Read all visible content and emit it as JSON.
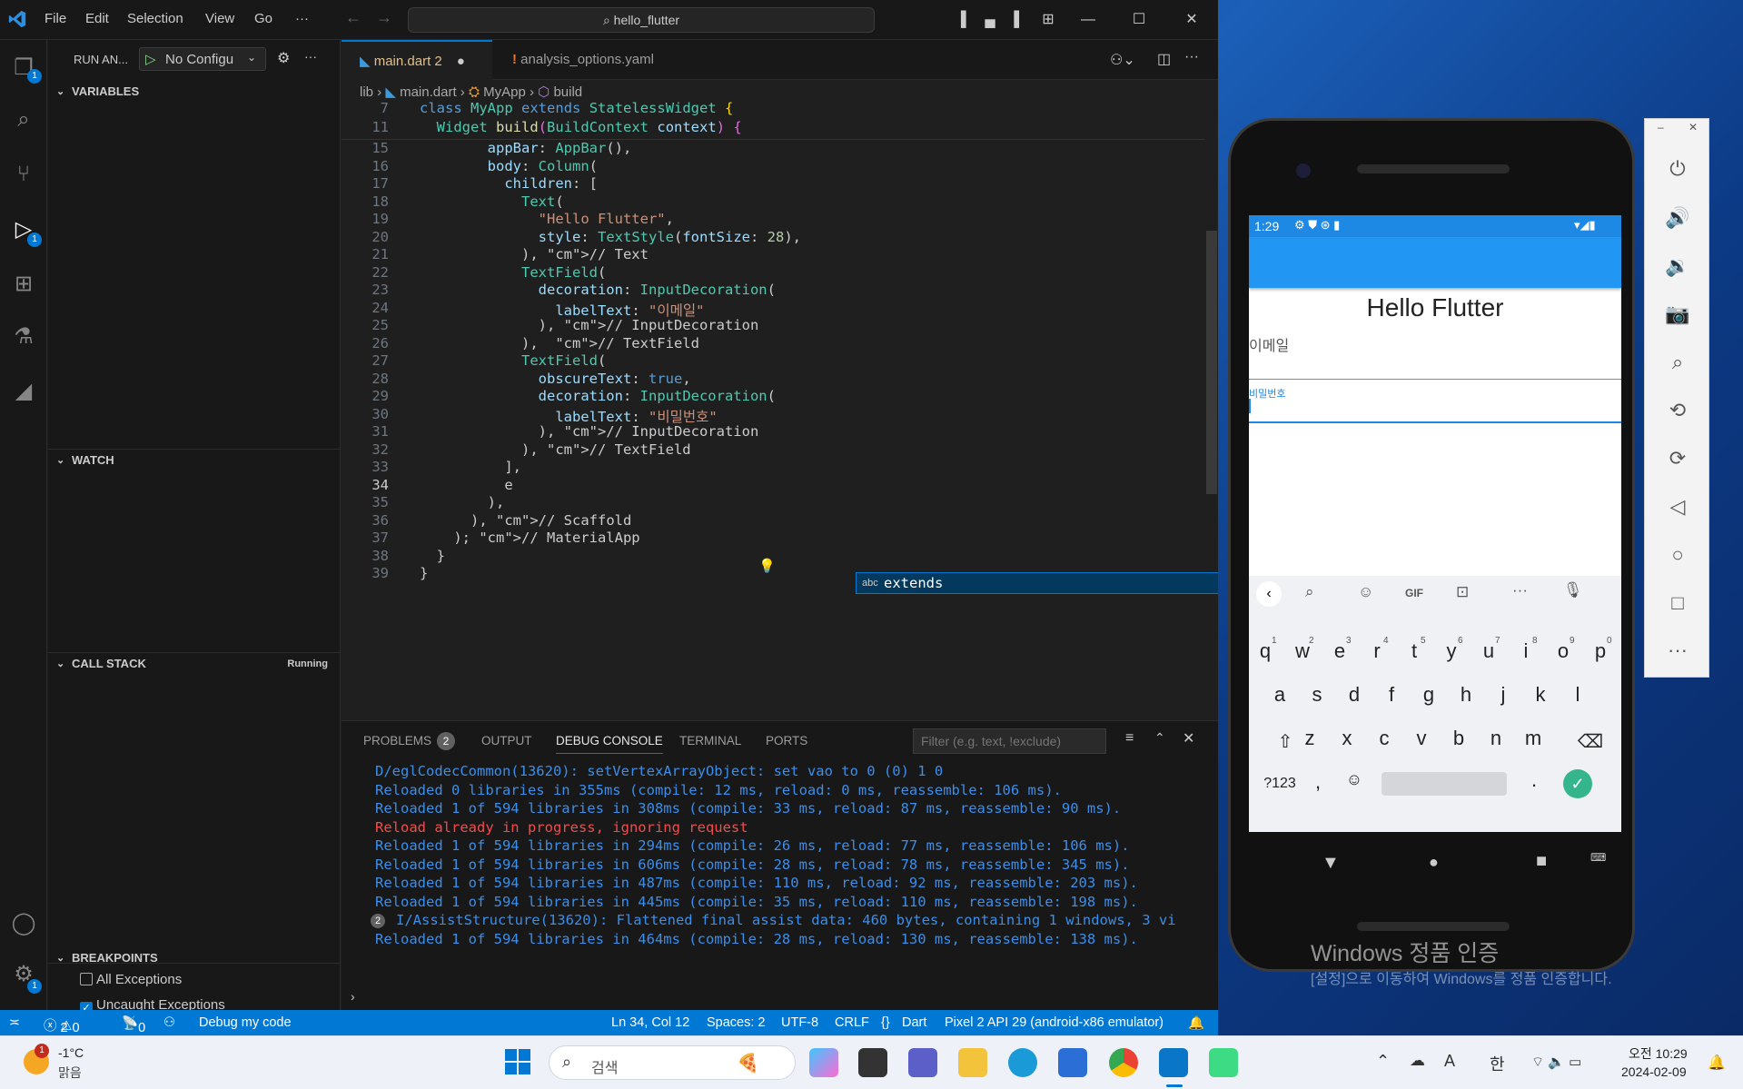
{
  "window": {
    "menus": [
      "File",
      "Edit",
      "Selection",
      "View",
      "Go",
      "···"
    ],
    "search": "hello_flutter"
  },
  "sidebar": {
    "run_label": "RUN AN...",
    "config": "No Configu",
    "variables": "VARIABLES",
    "watch": "WATCH",
    "call_stack": "CALL STACK",
    "call_stack_state": "Running",
    "breakpoints": "BREAKPOINTS",
    "all_exceptions": "All Exceptions",
    "uncaught_exceptions": "Uncaught Exceptions"
  },
  "activity": {
    "explorer_badge": "1",
    "debug_badge": "1",
    "settings_badge": "1"
  },
  "tabs": [
    {
      "label": "main.dart 2"
    },
    {
      "label": "analysis_options.yaml"
    }
  ],
  "breadcrumbs": [
    "lib",
    "main.dart",
    "MyApp",
    "build"
  ],
  "sticky": [
    {
      "ln": "7",
      "text": "class MyApp extends StatelessWidget {"
    },
    {
      "ln": "11",
      "text": "  Widget build(BuildContext context) {"
    }
  ],
  "code": [
    {
      "ln": "15",
      "text": "        appBar: AppBar(),"
    },
    {
      "ln": "16",
      "text": "        body: Column("
    },
    {
      "ln": "17",
      "text": "          children: ["
    },
    {
      "ln": "18",
      "text": "            Text("
    },
    {
      "ln": "19",
      "text": "              \"Hello Flutter\","
    },
    {
      "ln": "20",
      "text": "              style: TextStyle(fontSize: 28),"
    },
    {
      "ln": "21",
      "text": "            ), // Text"
    },
    {
      "ln": "22",
      "text": "            TextField("
    },
    {
      "ln": "23",
      "text": "              decoration: InputDecoration("
    },
    {
      "ln": "24",
      "text": "                labelText: \"이메일\""
    },
    {
      "ln": "25",
      "text": "              ), // InputDecoration"
    },
    {
      "ln": "26",
      "text": "            ),  // TextField"
    },
    {
      "ln": "27",
      "text": "            TextField("
    },
    {
      "ln": "28",
      "text": "              obscureText: true,"
    },
    {
      "ln": "29",
      "text": "              decoration: InputDecoration("
    },
    {
      "ln": "30",
      "text": "                labelText: \"비밀번호\""
    },
    {
      "ln": "31",
      "text": "              ), // InputDecoration"
    },
    {
      "ln": "32",
      "text": "            ), // TextField"
    },
    {
      "ln": "33",
      "text": "          ],"
    },
    {
      "ln": "34",
      "text": "          e"
    },
    {
      "ln": "35",
      "text": "        ),"
    },
    {
      "ln": "36",
      "text": "      ), // Scaffold"
    },
    {
      "ln": "37",
      "text": "    ); // MaterialApp"
    },
    {
      "ln": "38",
      "text": "  }"
    },
    {
      "ln": "39",
      "text": "}"
    }
  ],
  "suggest": {
    "kind": "abc",
    "label": "extends"
  },
  "panel": {
    "tabs": [
      "PROBLEMS",
      "OUTPUT",
      "DEBUG CONSOLE",
      "TERMINAL",
      "PORTS"
    ],
    "problems_count": "2",
    "filter_placeholder": "Filter (e.g. text, !exclude)",
    "lines": [
      {
        "t": "D/eglCodecCommon(13620): setVertexArrayObject: set vao to 0 (0) 1 0",
        "c": "#3b8eea"
      },
      {
        "t": "Reloaded 0 libraries in 355ms (compile: 12 ms, reload: 0 ms, reassemble: 106 ms).",
        "c": "#3b8eea"
      },
      {
        "t": "Reloaded 1 of 594 libraries in 308ms (compile: 33 ms, reload: 87 ms, reassemble: 90 ms).",
        "c": "#3b8eea"
      },
      {
        "t": "Reload already in progress, ignoring request",
        "c": "#f14c4c"
      },
      {
        "t": "Reloaded 1 of 594 libraries in 294ms (compile: 26 ms, reload: 77 ms, reassemble: 106 ms).",
        "c": "#3b8eea"
      },
      {
        "t": "Reloaded 1 of 594 libraries in 606ms (compile: 28 ms, reload: 78 ms, reassemble: 345 ms).",
        "c": "#3b8eea"
      },
      {
        "t": "Reloaded 1 of 594 libraries in 487ms (compile: 110 ms, reload: 92 ms, reassemble: 203 ms).",
        "c": "#3b8eea"
      },
      {
        "t": "Reloaded 1 of 594 libraries in 445ms (compile: 35 ms, reload: 110 ms, reassemble: 198 ms).",
        "c": "#3b8eea"
      },
      {
        "t": "I/AssistStructure(13620): Flattened final assist data: 460 bytes, containing 1 windows, 3 vi",
        "c": "#3b8eea"
      },
      {
        "t": "Reloaded 1 of 594 libraries in 464ms (compile: 28 ms, reload: 130 ms, reassemble: 138 ms).",
        "c": "#3b8eea"
      }
    ],
    "repeat_badge": "2"
  },
  "status": {
    "errors": "2",
    "warnings": "0",
    "ports": "0",
    "debug": "Debug my code",
    "pos": "Ln 34, Col 12",
    "spaces": "Spaces: 2",
    "enc": "UTF-8",
    "eol": "CRLF",
    "lang": "Dart",
    "device": "Pixel 2 API 29 (android-x86 emulator)"
  },
  "phone": {
    "time": "1:29",
    "title": "Hello Flutter",
    "email_label": "이메일",
    "password_label": "비밀번호",
    "kb_row1": [
      "q",
      "w",
      "e",
      "r",
      "t",
      "y",
      "u",
      "i",
      "o",
      "p"
    ],
    "kb_sup": [
      "1",
      "2",
      "3",
      "4",
      "5",
      "6",
      "7",
      "8",
      "9",
      "0"
    ],
    "kb_row2": [
      "a",
      "s",
      "d",
      "f",
      "g",
      "h",
      "j",
      "k",
      "l"
    ],
    "kb_row3": [
      "z",
      "x",
      "c",
      "v",
      "b",
      "n",
      "m"
    ],
    "kb_123": "?123",
    "kb_comma": ",",
    "kb_dot": ".",
    "gif": "GIF"
  },
  "watermark": {
    "line1": "Windows 정품 인증",
    "line2": "[설정]으로 이동하여 Windows를 정품 인증합니다."
  },
  "taskbar": {
    "weather_temp": "-1°C",
    "weather_desc": "맑음",
    "weather_badge": "1",
    "search": "검색",
    "ime": "한",
    "ime2": "A",
    "time": "오전 10:29",
    "date": "2024-02-09"
  }
}
